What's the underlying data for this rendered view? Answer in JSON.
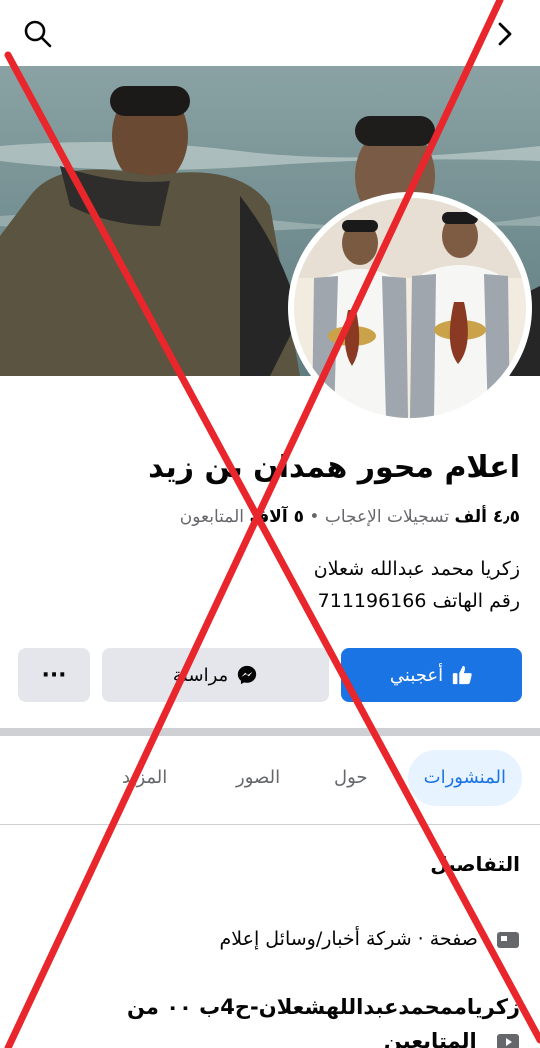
{
  "page": {
    "name": "اعلام محور همدان بن زيد",
    "stats": {
      "likes_value": "٤٫٥ ألف",
      "likes_label": "تسجيلات الإعجاب",
      "separator": "•",
      "followers_value": "٥ آلاف",
      "followers_label": "المتابعون"
    },
    "bio_line1": "زكريا محمد عبدالله شعلان",
    "bio_line2": "رقم الهاتف 711196166"
  },
  "actions": {
    "like_label": "أعجبني",
    "message_label": "مراسلة",
    "more_label": "···"
  },
  "tabs": [
    {
      "label": "المنشورات"
    },
    {
      "label": "حول"
    },
    {
      "label": "الصور"
    },
    {
      "label": "المزيد"
    }
  ],
  "details": {
    "title": "التفاصيل",
    "category": "صفحة · شركة أخبار/وسائل إعلام",
    "row2_line1": "زكرياممحمدعبداللهشعلان-ح4ب ٠٠ من",
    "row2_line2": "المتابعين"
  },
  "colors": {
    "accent": "#1b74e4",
    "overlay_x": "#e8262b"
  },
  "icons": [
    "search-icon",
    "chevron-right-icon",
    "thumbs-up-icon",
    "messenger-icon",
    "page-flag-icon",
    "followers-icon"
  ]
}
